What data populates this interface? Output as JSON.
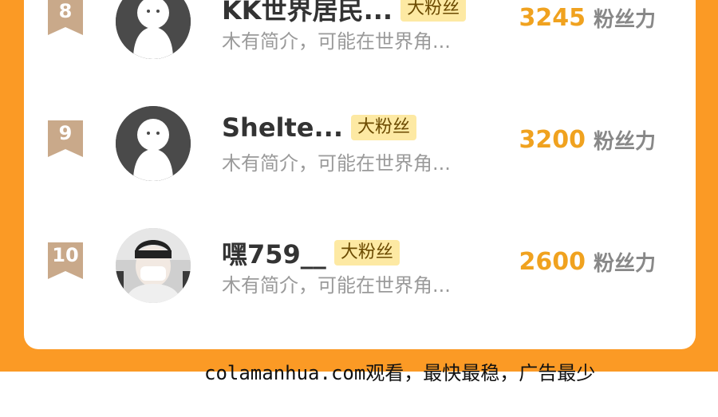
{
  "badge_label": "大粉丝",
  "score_unit": "粉丝力",
  "rows": [
    {
      "rank": "8",
      "name": "KK世界居民...",
      "bio": "木有简介，可能在世界角...",
      "score": "3245"
    },
    {
      "rank": "9",
      "name": "Shelte...",
      "bio": "木有简介，可能在世界角...",
      "score": "3200"
    },
    {
      "rank": "10",
      "name": "嘿759__",
      "bio": "木有简介，可能在世界角...",
      "score": "2600"
    }
  ],
  "footer": "colamanhua.com观看，最快最稳，广告最少",
  "colors": {
    "background": "#fb9a25",
    "score": "#f0a21f",
    "badge_bg": "#fde9a3",
    "rank_ribbon": "#c9a98a"
  }
}
